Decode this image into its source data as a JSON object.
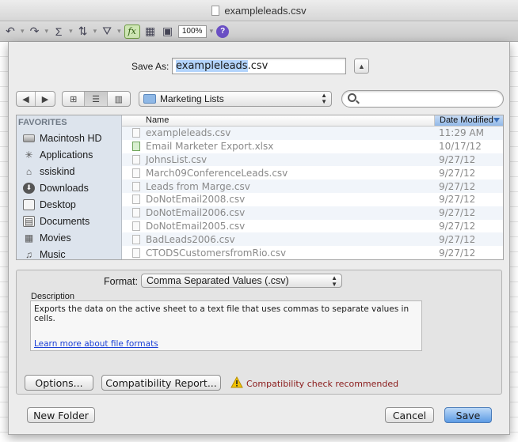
{
  "window": {
    "title": "exampleleads.csv"
  },
  "toolbar": {
    "zoom": "100%",
    "icons": [
      "undo-icon",
      "redo-icon",
      "autosum-icon",
      "sort-icon",
      "filter-icon",
      "formula-icon",
      "gallery-icon",
      "toolbox-icon",
      "help-icon"
    ]
  },
  "save_as": {
    "label": "Save As:",
    "filename_selected": "exampleleads",
    "filename_ext": ".csv"
  },
  "location": {
    "folder": "Marketing Lists"
  },
  "sidebar": {
    "heading": "FAVORITES",
    "items": [
      {
        "label": "Macintosh HD",
        "icon": "hard-drive-icon",
        "glyph": ""
      },
      {
        "label": "Applications",
        "icon": "applications-icon",
        "glyph": "✳"
      },
      {
        "label": "ssiskind",
        "icon": "home-icon",
        "glyph": "⌂"
      },
      {
        "label": "Downloads",
        "icon": "downloads-icon",
        "glyph": "⬇"
      },
      {
        "label": "Desktop",
        "icon": "desktop-icon",
        "glyph": ""
      },
      {
        "label": "Documents",
        "icon": "documents-icon",
        "glyph": "▤"
      },
      {
        "label": "Movies",
        "icon": "movies-icon",
        "glyph": "▦"
      },
      {
        "label": "Music",
        "icon": "music-icon",
        "glyph": "♫"
      }
    ]
  },
  "files": {
    "col_name": "Name",
    "col_date": "Date Modified",
    "rows": [
      {
        "name": "exampleleads.csv",
        "date": "11:29 AM",
        "type": "csv"
      },
      {
        "name": "Email Marketer Export.xlsx",
        "date": "10/17/12",
        "type": "xlsx"
      },
      {
        "name": "JohnsList.csv",
        "date": "9/27/12",
        "type": "csv"
      },
      {
        "name": "March09ConferenceLeads.csv",
        "date": "9/27/12",
        "type": "csv"
      },
      {
        "name": "Leads from Marge.csv",
        "date": "9/27/12",
        "type": "csv"
      },
      {
        "name": "DoNotEmail2008.csv",
        "date": "9/27/12",
        "type": "csv"
      },
      {
        "name": "DoNotEmail2006.csv",
        "date": "9/27/12",
        "type": "csv"
      },
      {
        "name": "DoNotEmail2005.csv",
        "date": "9/27/12",
        "type": "csv"
      },
      {
        "name": "BadLeads2006.csv",
        "date": "9/27/12",
        "type": "csv"
      },
      {
        "name": "CTODSCustomersfromRio.csv",
        "date": "9/27/12",
        "type": "csv"
      }
    ]
  },
  "format": {
    "label": "Format:",
    "selected": "Comma Separated Values (.csv)",
    "description_label": "Description",
    "description": "Exports the data on the active sheet to a text file that uses commas to separate values in cells.",
    "learn_more": "Learn more about file formats"
  },
  "buttons": {
    "options": "Options...",
    "compatibility_report": "Compatibility Report...",
    "compat_message": "Compatibility check recommended",
    "new_folder": "New Folder",
    "cancel": "Cancel",
    "save": "Save"
  },
  "colors": {
    "selection": "#b3d4fc",
    "save_button": "#5d9be4",
    "warning": "#f2c200",
    "link": "#1a3fd6"
  }
}
